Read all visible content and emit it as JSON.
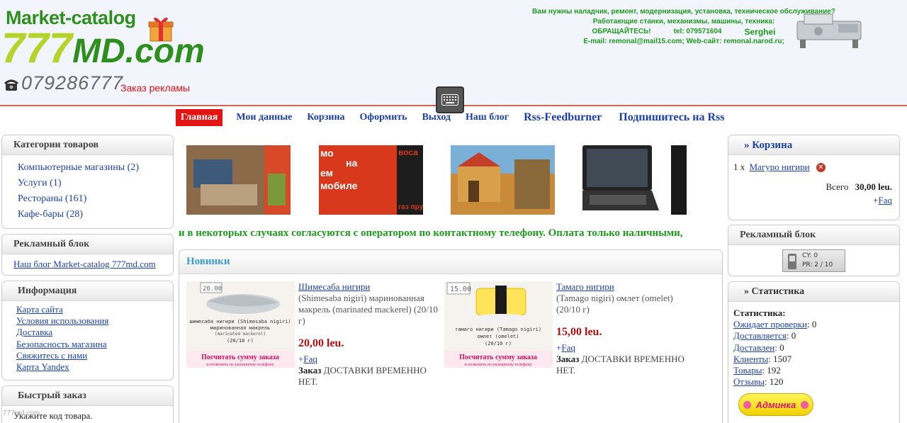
{
  "header": {
    "logo_top": "Market-catalog",
    "logo_big_a": "777",
    "logo_big_b": "MD.com",
    "phone": "079286777",
    "ad_order": "Заказ рекламы",
    "promo": {
      "line1": "Вам нужны наладчик, ремонт, модернизация, установка, техническое обслуживание?",
      "line2": "Работающие станки, механизмы, машины, техника:",
      "line3_a": "ОБРАЩАЙТЕСЬ!",
      "line3_b": "tel: 079571604",
      "line3_c": "Serghei",
      "line4": "E-mail: remonal@mail15.com; Web-сайт: remonal.narod.ru;"
    }
  },
  "nav": {
    "items": [
      "Главная",
      "Мои данные",
      "Корзина",
      "Оформить",
      "Выход",
      "Наш блог",
      "Rss-Feedburner",
      "Подпишитесь на Rss"
    ]
  },
  "categories": {
    "title": "Категории товаров",
    "items": [
      "Компьютерные магазины (2)",
      "Услуги (1)",
      "Рестораны (161)",
      "Кафе-бары (28)"
    ]
  },
  "ad_left": {
    "title": "Рекламный блок",
    "link": "Наш блог Market-catalog 777md.com"
  },
  "info": {
    "title": "Информация",
    "items": [
      "Карта сайта",
      "Условия использования",
      "Доставка",
      "Безопасность магазина",
      "Свяжитесь с нами",
      "Карта Yandex"
    ]
  },
  "quick_order": {
    "title": "Быстрый заказ",
    "text": "Укажите код товара.",
    "watermark": "777md.com"
  },
  "banners": {
    "b2_words": [
      "мо",
      "на",
      "ем",
      "мобиле"
    ],
    "b2_side_top": "воса",
    "b2_side_bottom": "газ прун"
  },
  "ticker": "и в некоторых случаях согласуются с оператором по контактному телефону. Оплата только наличными,",
  "new_products": {
    "title": "Новинки",
    "products": [
      {
        "img_price": "20.00",
        "img_name": "шимесаба нигири (Shimesaba nigiri)",
        "img_desc": "маринованная макрель",
        "img_desc2": "(marinated mackerel)",
        "img_weight": "(20/10 г)",
        "img_banner": "Посчитать сумму заказа",
        "img_banner2": "и позвонить по указанному телефону",
        "title": "Шимесаба нигири",
        "desc": "(Shimesaba nigiri) маринованная макрель (marinated mackerel) (20/10 г)",
        "price": "20,00 leu.",
        "faq": "Faq",
        "order_label": "Заказ",
        "order_text": "ДОСТАВКИ ВРЕМЕННО НЕТ."
      },
      {
        "img_price": "15.00",
        "img_name": "тамаго нигири (Tamago nigiri)",
        "img_desc": "омлет (omelet)",
        "img_desc2": "",
        "img_weight": "(20/10 г)",
        "img_banner": "Посчитать сумму заказа",
        "img_banner2": "и позвонить по указанному телефону",
        "title": "Тамаго нигири",
        "desc": "(Tamago nigiri) омлет (omelet) (20/10 г)",
        "price": "15,00 leu.",
        "faq": "Faq",
        "order_label": "Заказ",
        "order_text": "ДОСТАВКИ ВРЕМЕННО НЕТ."
      }
    ]
  },
  "cart": {
    "title": "» Корзина",
    "qty": "1 x",
    "item": "Магуро нигири",
    "total_label": "Всего",
    "total_value": "30,00 leu.",
    "faq": "Faq"
  },
  "ad_right": {
    "title": "Рекламный блок",
    "cy": "CY: 0",
    "pr": "PR: 2 / 10"
  },
  "stats": {
    "title": "» Статистика",
    "heading": "Статистика:",
    "rows": [
      {
        "label": "Ожидает проверки",
        "value": ": 0"
      },
      {
        "label": "Доставляется",
        "value": ": 0"
      },
      {
        "label": "Доставлен",
        "value": ": 0"
      },
      {
        "label": "Клиенты",
        "value": ": 1507"
      },
      {
        "label": "Товары",
        "value": ": 192"
      },
      {
        "label": "Отзывы",
        "value": ": 120"
      }
    ],
    "admin": "Админка"
  },
  "colors": {
    "accent_red": "#e41414",
    "link_blue": "#1a3fa8",
    "ticker_green": "#1c9a1c"
  }
}
